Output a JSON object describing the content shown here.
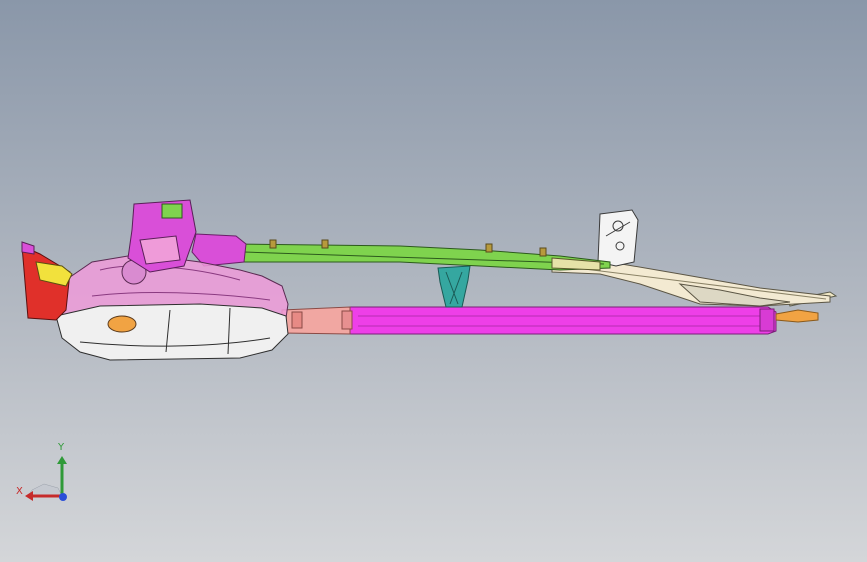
{
  "viewport": {
    "background_top": "#8a97a9",
    "background_bottom": "#d4d6d9"
  },
  "model": {
    "name": "chassis-frame-assembly",
    "part_colors": {
      "front_body": "#ef9bd9",
      "front_panel": "#f0f0f0",
      "tower": "#d94fd8",
      "upper_rail": "#7fd34e",
      "lower_rail": "#ee3fe8",
      "lower_rail_front": "#f1a7a2",
      "rear_rail": "#f3ead2",
      "brace": "#35a7a0",
      "rear_bracket": "#f4f4f4",
      "front_red": "#e0302a",
      "front_yellow": "#f2e13c",
      "orange_pad": "#f1a343"
    }
  },
  "triad": {
    "x_label": "X",
    "y_label": "Y",
    "x_color": "#c62b2b",
    "y_color": "#2f9a38",
    "z_color": "#2a4fd8"
  }
}
